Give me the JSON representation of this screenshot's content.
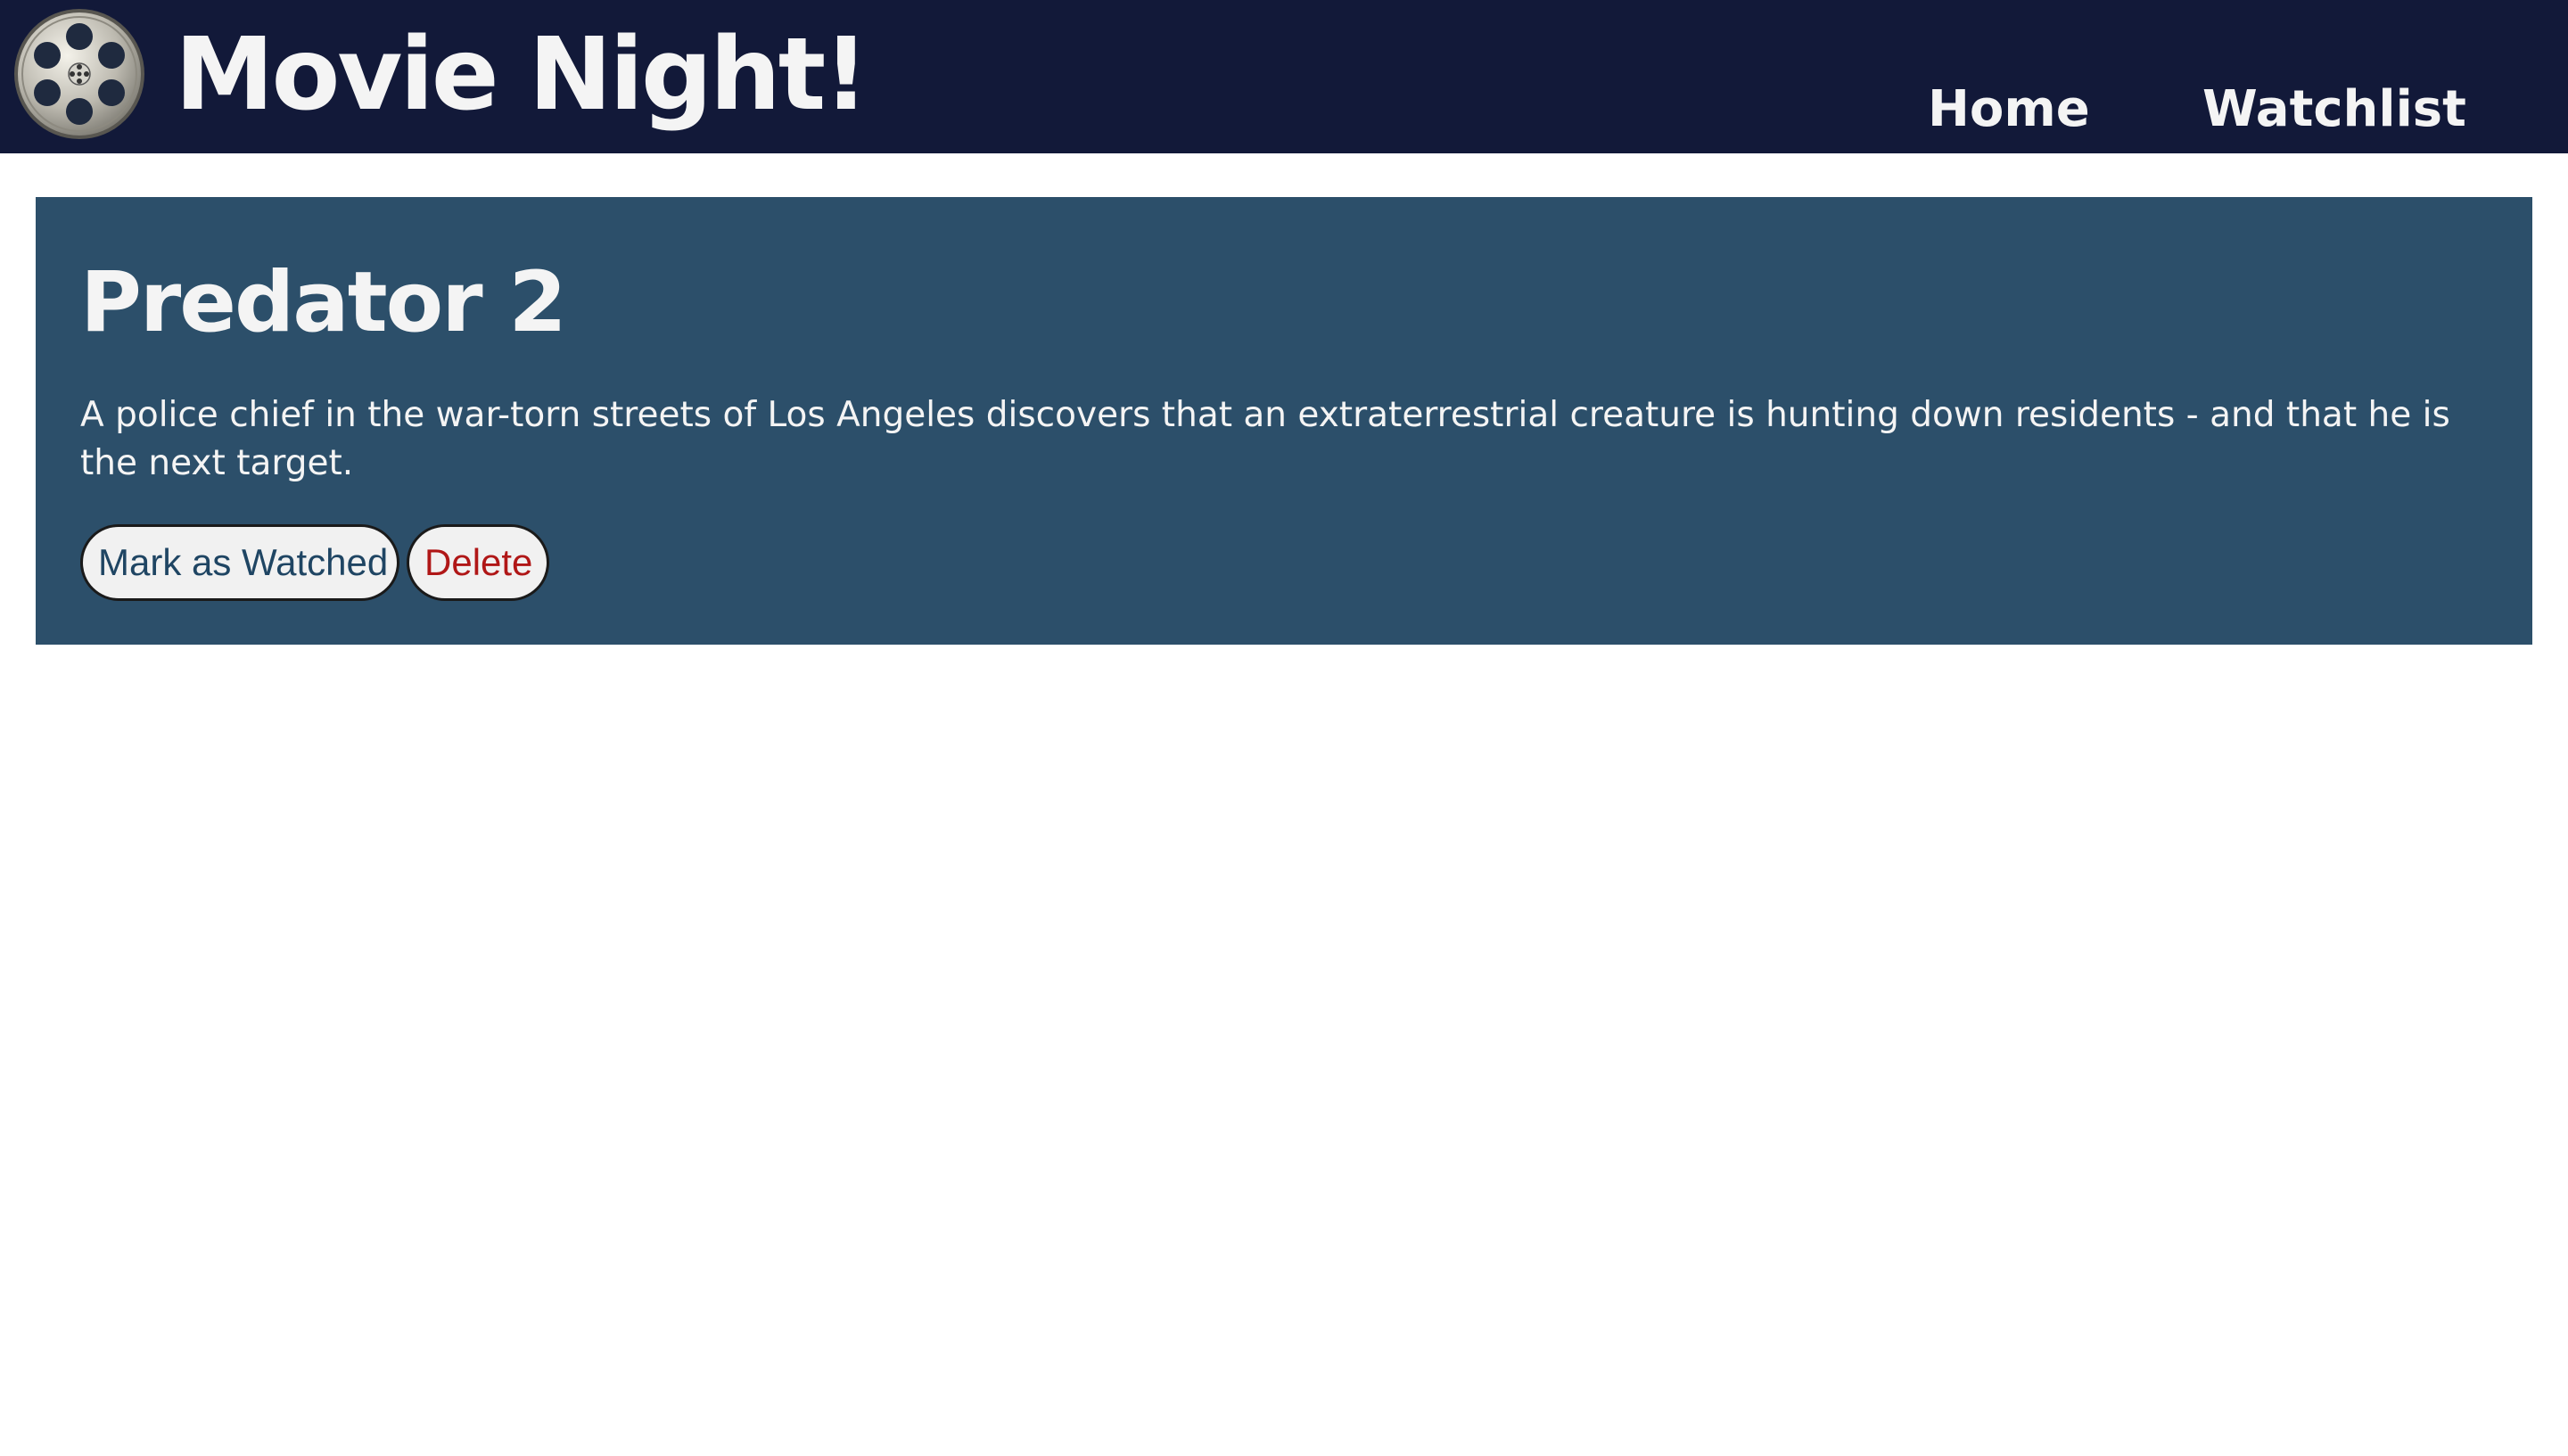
{
  "header": {
    "logo_icon": "film-reel-icon",
    "site_title": "Movie Night!",
    "nav": {
      "home_label": "Home",
      "watchlist_label": "Watchlist"
    },
    "background_color": "#121939"
  },
  "movie": {
    "title": "Predator 2",
    "description": "A police chief in the war-torn streets of Los Angeles discovers that an extraterrestrial creature is hunting down residents - and that he is the next target.",
    "card_color": "#2c4f6a",
    "actions": {
      "mark_watched_label": "Mark as Watched",
      "delete_label": "Delete"
    }
  },
  "colors": {
    "watched_text": "#1f4563",
    "delete_text": "#b01717"
  }
}
